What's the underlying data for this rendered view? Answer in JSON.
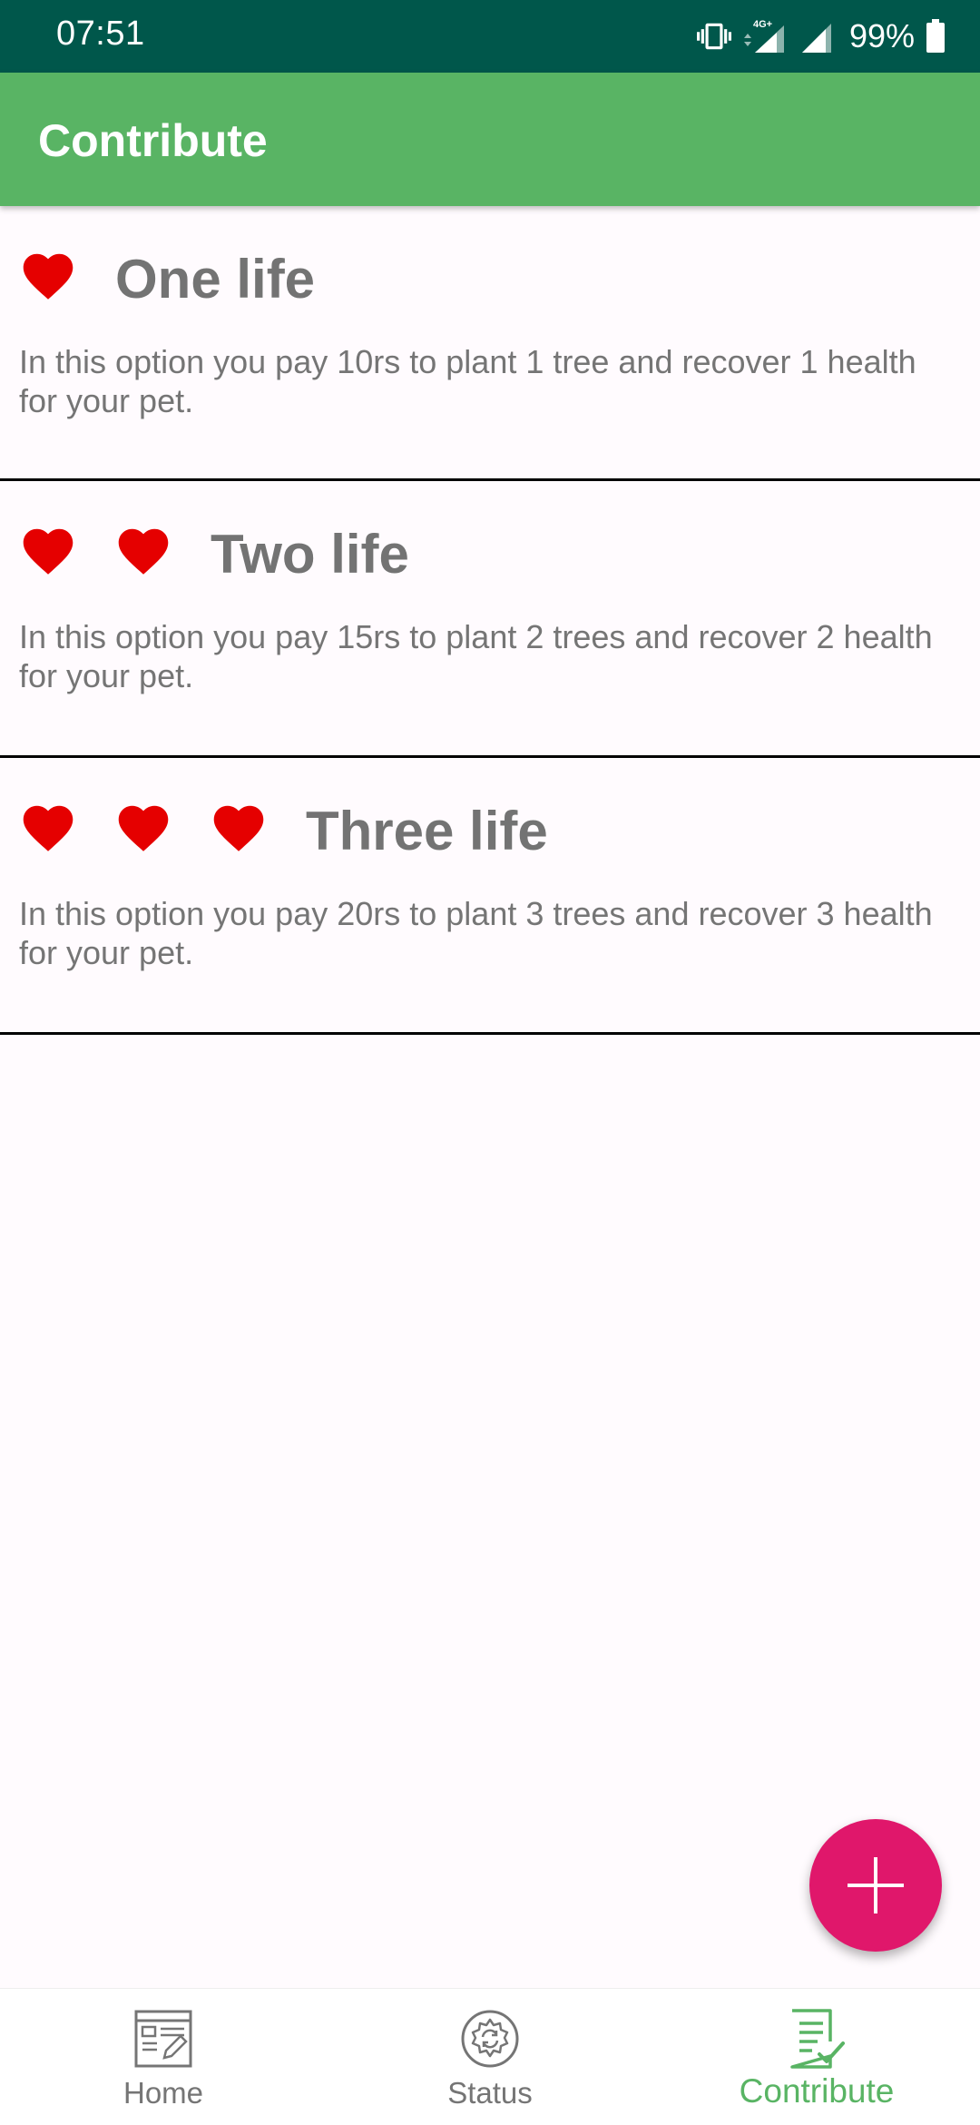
{
  "status_bar": {
    "time": "07:51",
    "network": "4G+",
    "battery": "99%",
    "icons": [
      "vibrate-icon",
      "signal-4g-icon",
      "signal-icon",
      "battery-icon"
    ]
  },
  "app_bar": {
    "title": "Contribute"
  },
  "options": [
    {
      "hearts": 1,
      "title": "One life",
      "description": "In this option you pay 10rs to plant 1 tree and recover 1 health for your pet."
    },
    {
      "hearts": 2,
      "title": "Two life",
      "description": "In this option you pay 15rs to plant 2 trees and recover 2 health for your pet."
    },
    {
      "hearts": 3,
      "title": "Three life",
      "description": "In this option you pay 20rs to plant 3 trees and recover 3 health for your pet."
    }
  ],
  "fab": {
    "icon": "plus-icon"
  },
  "bottom_nav": {
    "items": [
      {
        "label": "Home",
        "icon": "home-dashboard-icon",
        "active": false
      },
      {
        "label": "Status",
        "icon": "status-gear-icon",
        "active": false
      },
      {
        "label": "Contribute",
        "icon": "contribute-checklist-icon",
        "active": true
      }
    ]
  },
  "colors": {
    "status_bar": "#00574b",
    "app_bar": "#59b464",
    "heart": "#e50000",
    "fab": "#e0176b",
    "nav_active": "#59b464",
    "nav_inactive": "#757575"
  }
}
